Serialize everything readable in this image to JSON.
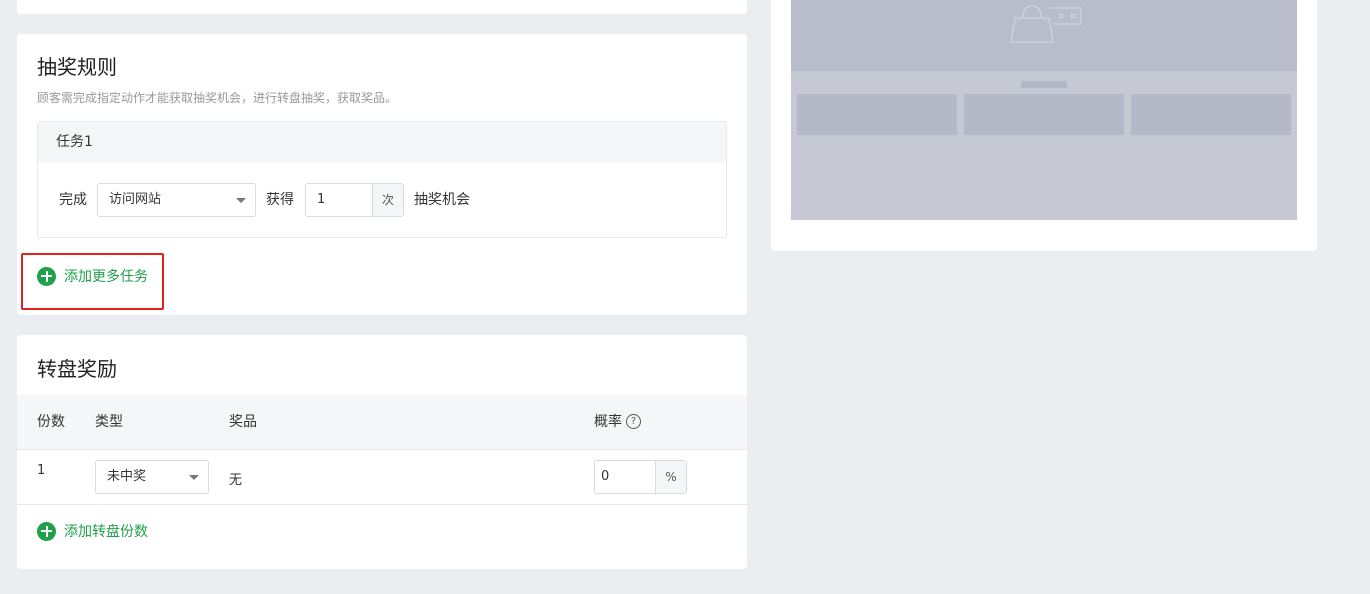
{
  "rules": {
    "title": "抽奖规则",
    "description": "顾客需完成指定动作才能获取抽奖机会，进行转盘抽奖，获取奖品。",
    "task": {
      "header": "任务1",
      "complete_label": "完成",
      "action_select": "访问网站",
      "get_label": "获得",
      "count_value": "1",
      "count_unit": "次",
      "chance_label": "抽奖机会"
    },
    "add_task_label": "添加更多任务"
  },
  "wheel": {
    "title": "转盘奖励",
    "columns": {
      "share": "份数",
      "type": "类型",
      "prize": "奖品",
      "probability": "概率"
    },
    "rows": [
      {
        "share": "1",
        "type": "未中奖",
        "prize": "无",
        "probability": "0",
        "probability_unit": "%"
      }
    ],
    "add_share_label": "添加转盘份数"
  },
  "colors": {
    "accent_green": "#21a04b",
    "highlight_red": "#e02222"
  }
}
